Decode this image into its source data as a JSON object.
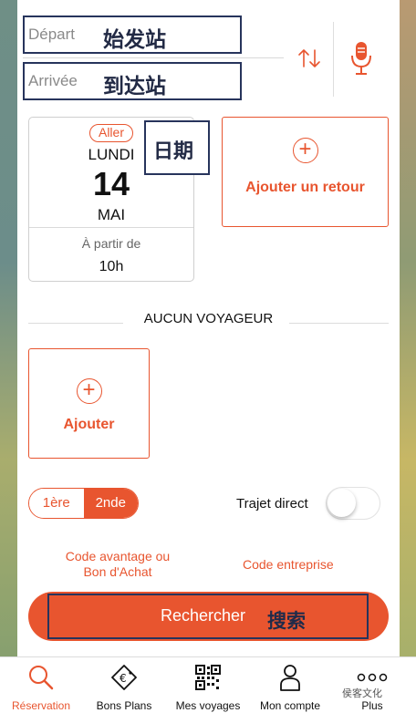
{
  "colors": {
    "accent": "#e8552f",
    "annotation_border": "#27345c",
    "text_dark": "#111111"
  },
  "search_form": {
    "depart": {
      "label": "Départ",
      "value": "始发站"
    },
    "arrivee": {
      "label": "Arrivée",
      "value": "到达站"
    }
  },
  "icons": {
    "swap": "swap-arrows-icon",
    "mic": "microphone-icon"
  },
  "outbound": {
    "badge": "Aller",
    "weekday": "LUNDI",
    "day": "14",
    "month": "MAI",
    "from_label": "À partir de",
    "time": "10h",
    "annotation": "日期"
  },
  "return": {
    "label": "Ajouter un retour"
  },
  "travellers": {
    "title": "AUCUN VOYAGEUR",
    "add_label": "Ajouter"
  },
  "travel_class": {
    "first": "1ère",
    "second": "2nde",
    "selected": "2nde"
  },
  "direct": {
    "label": "Trajet direct",
    "enabled": false
  },
  "codes": {
    "avantage": "Code avantage ou Bon d'Achat",
    "entreprise": "Code entreprise"
  },
  "search_button": {
    "label": "Rechercher",
    "annotation": "搜索"
  },
  "tabbar": {
    "tabs": [
      {
        "label": "Réservation",
        "icon": "search-icon",
        "active": true
      },
      {
        "label": "Bons Plans",
        "icon": "euro-tag-icon",
        "active": false
      },
      {
        "label": "Mes voyages",
        "icon": "qr-code-icon",
        "active": false
      },
      {
        "label": "Mon compte",
        "icon": "user-icon",
        "active": false
      },
      {
        "label": "Plus",
        "icon": "more-dots-icon",
        "active": false
      }
    ]
  },
  "watermark": "侯客文化"
}
